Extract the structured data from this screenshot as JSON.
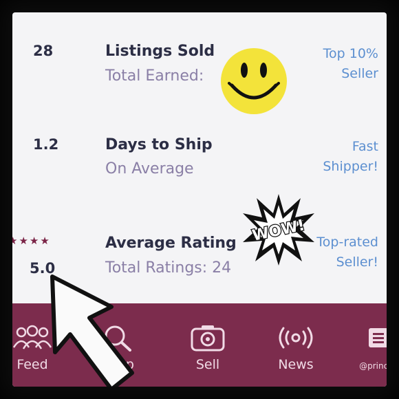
{
  "stats": [
    {
      "value": "28",
      "title": "Listings Sold",
      "subtitle": "Total Earned:",
      "badge_line1": "Top 10%",
      "badge_line2": "Seller"
    },
    {
      "value": "1.2",
      "title": "Days to Ship",
      "subtitle": "On Average",
      "badge_line1": "Fast",
      "badge_line2": "Shipper!"
    },
    {
      "value": "5.0",
      "title": "Average Rating",
      "subtitle": "Total Ratings: 24",
      "badge_line1": "Top-rated",
      "badge_line2": "Seller!"
    }
  ],
  "rating_stars": "★★★★",
  "rating_value": 5,
  "stickers": {
    "wow_text": "WOW!"
  },
  "tabs": [
    {
      "label": "Feed",
      "icon": "people-icon"
    },
    {
      "label": "Shop",
      "icon": "search-icon"
    },
    {
      "label": "Sell",
      "icon": "camera-icon"
    },
    {
      "label": "News",
      "icon": "broadcast-icon"
    },
    {
      "label": "@princes",
      "icon": "menu-icon"
    }
  ],
  "colors": {
    "accent": "#7c2c4d",
    "link": "#5c8fd0",
    "text": "#2c2e45",
    "muted": "#8a7fa6"
  }
}
